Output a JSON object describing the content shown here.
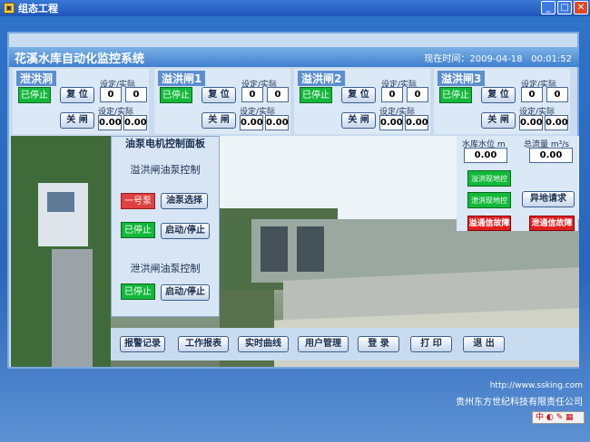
{
  "window": {
    "title": "组态工程"
  },
  "header": {
    "title": "花溪水库自动化监控系统",
    "time_label": "现在时间：",
    "date": "2009-04-18",
    "time": "00:01:52"
  },
  "common": {
    "setting_label": "设定/实际  cm",
    "setting_label2": "设定/实际m³/s"
  },
  "gates": [
    {
      "name": "泄洪洞",
      "status": "已停止",
      "reset": "复 位",
      "close": "关 闸",
      "set": "0",
      "actual": "0",
      "set2": "0.00",
      "actual2": "0.00"
    },
    {
      "name": "溢洪闸1",
      "status": "已停止",
      "reset": "复 位",
      "close": "关 闸",
      "set": "0",
      "actual": "0",
      "set2": "0.00",
      "actual2": "0.00"
    },
    {
      "name": "溢洪闸2",
      "status": "已停止",
      "reset": "复 位",
      "close": "关 闸",
      "set": "0",
      "actual": "0",
      "set2": "0.00",
      "actual2": "0.00"
    },
    {
      "name": "溢洪闸3",
      "status": "已停止",
      "reset": "复 位",
      "close": "关 闸",
      "set": "0",
      "actual": "0",
      "set2": "0.00",
      "actual2": "0.00"
    }
  ],
  "pump": {
    "title": "油泵电机控制面板",
    "sub1": "溢洪闸油泵控制",
    "pump1": "一号泵",
    "select": "油泵选择",
    "status1": "已停止",
    "startstop1": "启动/停止",
    "sub2": "泄洪闸油泵控制",
    "status2": "已停止",
    "startstop2": "启动/停止"
  },
  "right": {
    "level_label": "水库水位 m",
    "flow_label": "总流量 m³/s",
    "level": "0.00",
    "flow": "0.00",
    "overflow_local": "溢洪现地控制",
    "drain_local": "泄洪现地控制",
    "remote": "异地请求",
    "overflow_fault": "溢通信故障",
    "drain_fault": "泄通信故障"
  },
  "bottom": [
    "报警记录",
    "工作报表",
    "实时曲线",
    "用户管理",
    "登 录",
    "打 印",
    "退 出"
  ],
  "footer": {
    "url": "http://www.ssking.com",
    "company": "贵州东方世纪科技有限责任公司"
  },
  "tray": {
    "ime": "中"
  }
}
